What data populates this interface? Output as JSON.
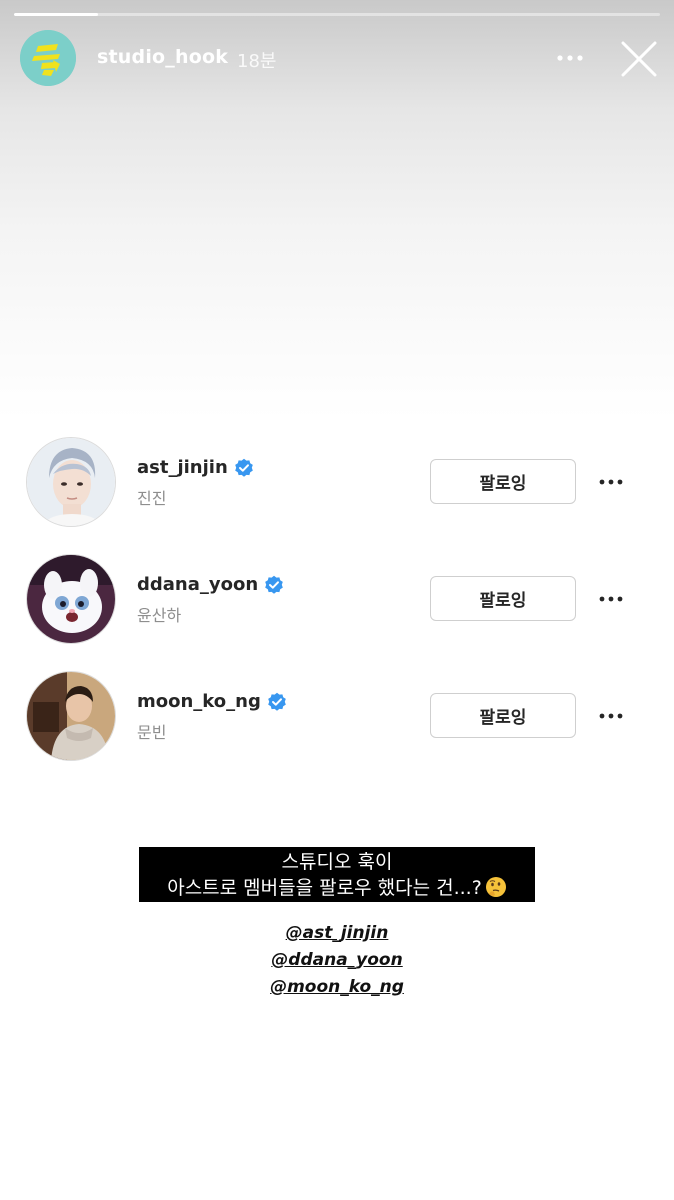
{
  "story": {
    "progress_fraction": 0.13,
    "account": {
      "username": "studio_hook",
      "time": "18분"
    },
    "logo": {
      "accent": "#7ccfc9",
      "glyph_color": "#f0e21e"
    }
  },
  "following": [
    {
      "handle": "ast_jinjin",
      "name": "진진",
      "button": "팔로잉",
      "verified": true
    },
    {
      "handle": "ddana_yoon",
      "name": "윤산하",
      "button": "팔로잉",
      "verified": true
    },
    {
      "handle": "moon_ko_ng",
      "name": "문빈",
      "button": "팔로잉",
      "verified": true
    }
  ],
  "caption": {
    "line1": "스튜디오 훅이",
    "line2": "아스트로 멤버들을 팔로우 했다는 건...?",
    "emoji": "thinking-face-icon"
  },
  "mentions": [
    "@ast_jinjin",
    "@ddana_yoon",
    "@moon_ko_ng"
  ],
  "colors": {
    "verified_badge": "#3897f0",
    "caption_bg": "#000000"
  }
}
